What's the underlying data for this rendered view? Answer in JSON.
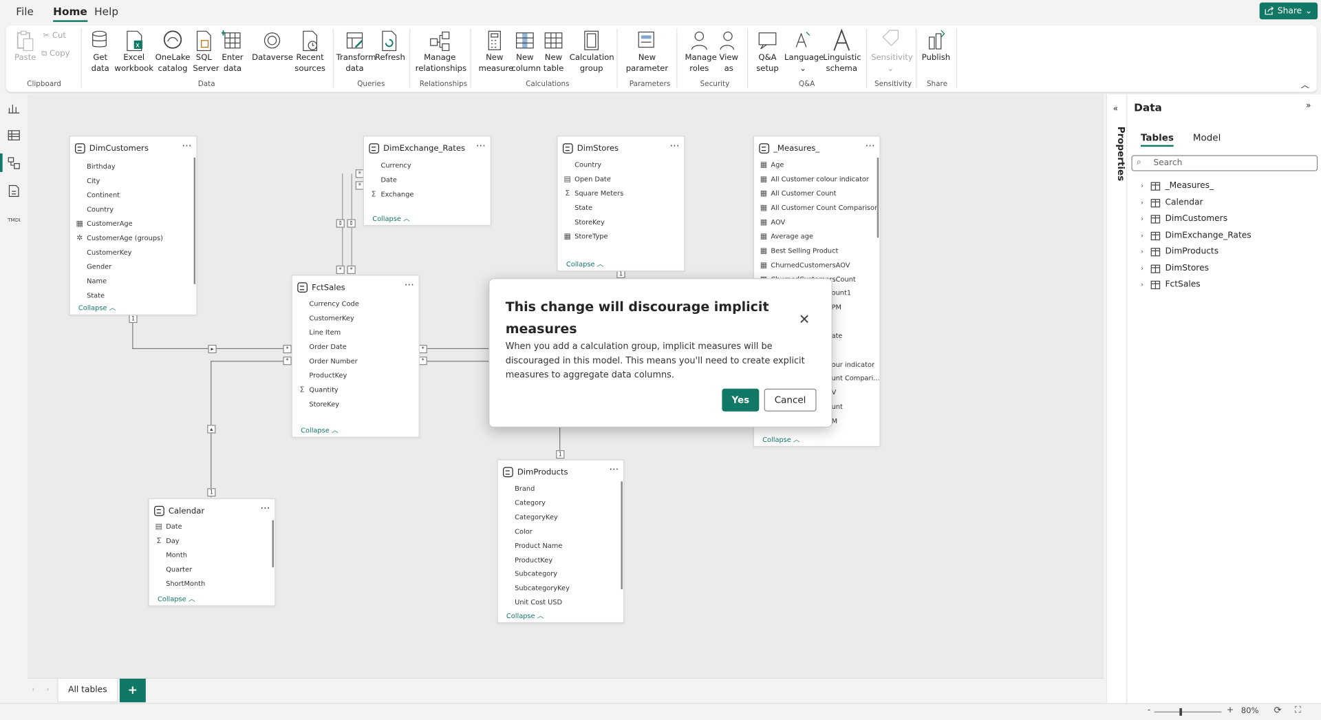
{
  "menu": {
    "file": "File",
    "home": "Home",
    "help": "Help",
    "share": "Share"
  },
  "ribbon": {
    "clipboard": {
      "paste": "Paste",
      "cut": "Cut",
      "copy": "Copy",
      "group": "Clipboard"
    },
    "data": {
      "get_data": "Get data",
      "excel": "Excel workbook",
      "onelake": "OneLake catalog",
      "sql": "SQL Server",
      "enter": "Enter data",
      "dataverse": "Dataverse",
      "recent": "Recent sources",
      "group": "Data"
    },
    "queries": {
      "transform": "Transform data",
      "refresh": "Refresh",
      "group": "Queries"
    },
    "relationships": {
      "manage": "Manage relationships",
      "group": "Relationships"
    },
    "calculations": {
      "new_measure": "New measure",
      "new_column": "New column",
      "new_table": "New table",
      "calc_group": "Calculation group",
      "group": "Calculations"
    },
    "parameters": {
      "new_param": "New parameter",
      "group": "Parameters"
    },
    "security": {
      "manage_roles": "Manage roles",
      "view_as": "View as",
      "group": "Security"
    },
    "qa": {
      "qa_setup": "Q&A setup",
      "language": "Language",
      "linguistic": "Linguistic schema",
      "group": "Q&A"
    },
    "sensitivity": {
      "label": "Sensitivity",
      "group": "Sensitivity"
    },
    "share": {
      "publish": "Publish",
      "group": "Share"
    }
  },
  "tables": {
    "dimcustomers": {
      "title": "DimCustomers",
      "fields": [
        "Birthday",
        "City",
        "Continent",
        "Country",
        "CustomerAge",
        "CustomerAge (groups)",
        "CustomerKey",
        "Gender",
        "Name",
        "State"
      ],
      "collapse": "Collapse"
    },
    "dimexchange": {
      "title": "DimExchange_Rates",
      "fields": [
        "Currency",
        "Date",
        "Exchange"
      ],
      "collapse": "Collapse"
    },
    "dimstores": {
      "title": "DimStores",
      "fields": [
        "Country",
        "Open Date",
        "Square Meters",
        "State",
        "StoreKey",
        "StoreType"
      ],
      "collapse": "Collapse"
    },
    "measures": {
      "title": "_Measures_",
      "fields": [
        "Age",
        "All Customer colour indicator",
        "All Customer Count",
        "All Customer Count Comparison",
        "AOV",
        "Average age",
        "Best Selling Product",
        "ChurnedCustomersAOV",
        "ChurnedCustomersCount"
      ],
      "partial": [
        "ount1",
        "PM",
        "ate",
        "our indicator",
        "unt Compari...",
        "V",
        "unt",
        "M"
      ],
      "collapse": "Collapse"
    },
    "fctsales": {
      "title": "FctSales",
      "fields": [
        "Currency Code",
        "CustomerKey",
        "Line Item",
        "Order Date",
        "Order Number",
        "ProductKey",
        "Quantity",
        "StoreKey"
      ],
      "collapse": "Collapse"
    },
    "calendar": {
      "title": "Calendar",
      "fields": [
        "Date",
        "Day",
        "Month",
        "Quarter",
        "ShortMonth"
      ],
      "collapse": "Collapse"
    },
    "dimproducts": {
      "title": "DimProducts",
      "fields": [
        "Brand",
        "Category",
        "CategoryKey",
        "Color",
        "Product Name",
        "ProductKey",
        "Subcategory",
        "SubcategoryKey",
        "Unit Cost USD"
      ],
      "collapse": "Collapse"
    }
  },
  "data_pane": {
    "title": "Data",
    "properties": "Properties",
    "tab_tables": "Tables",
    "tab_model": "Model",
    "search_placeholder": "Search",
    "items": [
      "_Measures_",
      "Calendar",
      "DimCustomers",
      "DimExchange_Rates",
      "DimProducts",
      "DimStores",
      "FctSales"
    ]
  },
  "tabs": {
    "all_tables": "All tables",
    "add": "+"
  },
  "status": {
    "zoom": "80%"
  },
  "dialog": {
    "title": "This change will discourage implicit measures",
    "body": "When you add a calculation group, implicit measures will be discouraged in this model. This means you'll need to create explicit measures to aggregate data columns.",
    "yes": "Yes",
    "cancel": "Cancel"
  },
  "colors": {
    "accent": "#117865"
  }
}
